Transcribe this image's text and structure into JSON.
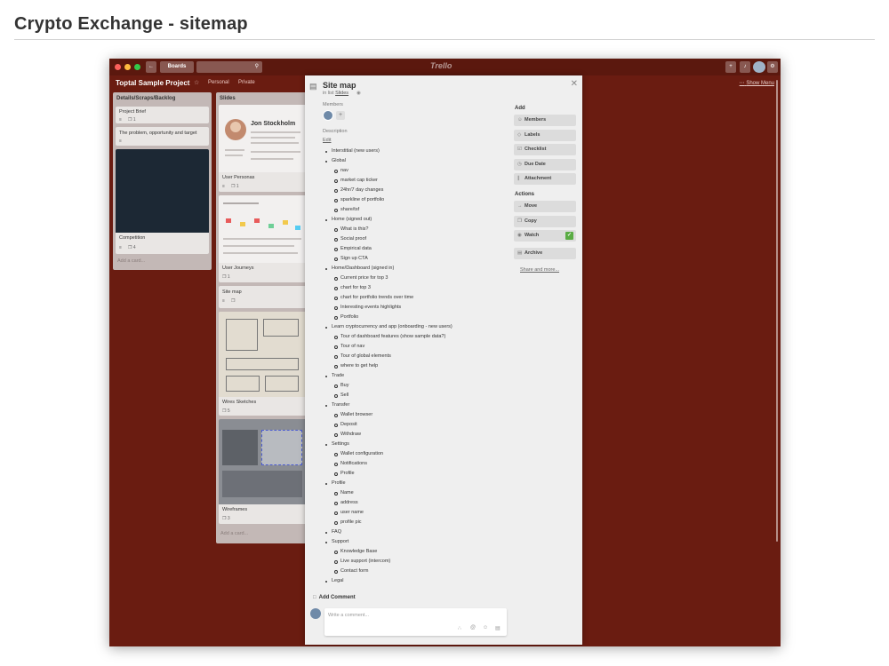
{
  "page": {
    "title": "Crypto Exchange - sitemap"
  },
  "topbar": {
    "boards_label": "Boards",
    "logo": "Trello",
    "icons": [
      "back-arrow-icon",
      "search-icon",
      "plus-icon",
      "bell-icon",
      "settings-icon"
    ]
  },
  "board": {
    "title": "Toptal Sample Project",
    "personal": "Personal",
    "private": "Private",
    "show_menu": "Show Menu"
  },
  "lists": [
    {
      "title": "Details/Scraps/Backlog",
      "cards": [
        {
          "title": "Project Brief",
          "badges": [
            "≡",
            "❐ 1"
          ]
        },
        {
          "title": "The problem, opportunity and target",
          "badges": [
            "≡"
          ]
        },
        {
          "title": "Competition",
          "badges": [
            "≡",
            "❐ 4"
          ]
        }
      ],
      "add_card": "Add a card..."
    },
    {
      "title": "Slides",
      "persona_name": "Jon Stockholm",
      "cards": [
        {
          "title": "User Personas",
          "badges": [
            "≡",
            "❐ 1"
          ]
        },
        {
          "title": "User Journeys",
          "badges": [
            "❐ 1"
          ]
        },
        {
          "title": "Site map",
          "badges": [
            "≡",
            "❐"
          ]
        },
        {
          "title": "Wires Sketches",
          "badges": [
            "❐ 5"
          ]
        },
        {
          "title": "Wireframes",
          "badges": [
            "❐ 3"
          ]
        }
      ],
      "add_card": "Add a card..."
    }
  ],
  "modal": {
    "title": "Site map",
    "in_list_prefix": "in list",
    "in_list_name": "Slides",
    "members_label": "Members",
    "description_label": "Description",
    "edit_label": "Edit",
    "sitemap": [
      {
        "text": "Interstitial (new users)",
        "level": 0
      },
      {
        "text": "Global",
        "level": 0
      },
      {
        "text": "nav",
        "level": 1
      },
      {
        "text": "market cap ticker",
        "level": 1
      },
      {
        "text": "24hr/7 day changes",
        "level": 1
      },
      {
        "text": "sparkline of portfolio",
        "level": 1
      },
      {
        "text": "share/tsf",
        "level": 1
      },
      {
        "text": "Home (signed out)",
        "level": 0
      },
      {
        "text": "What is this?",
        "level": 1
      },
      {
        "text": "Social proof",
        "level": 1
      },
      {
        "text": "Empirical data",
        "level": 1
      },
      {
        "text": "Sign up CTA",
        "level": 1
      },
      {
        "text": "Home/Dashboard (signed in)",
        "level": 0
      },
      {
        "text": "Current price for top 3",
        "level": 1
      },
      {
        "text": "chart for top 3",
        "level": 1
      },
      {
        "text": "chart for portfolio trends over time",
        "level": 1
      },
      {
        "text": "Interesting events highlights",
        "level": 1
      },
      {
        "text": "Portfolio",
        "level": 1
      },
      {
        "text": "Learn cryptocurrency and app (onboarding - new users)",
        "level": 0
      },
      {
        "text": "Tour of dashboard features (show sample data?)",
        "level": 1
      },
      {
        "text": "Tour of nav",
        "level": 1
      },
      {
        "text": "Tour of global elements",
        "level": 1
      },
      {
        "text": "where to get help",
        "level": 1
      },
      {
        "text": "Trade",
        "level": 0
      },
      {
        "text": "Buy",
        "level": 1
      },
      {
        "text": "Sell",
        "level": 1
      },
      {
        "text": "Transfer",
        "level": 0
      },
      {
        "text": "Wallet browser",
        "level": 1
      },
      {
        "text": "Deposit",
        "level": 1
      },
      {
        "text": "Withdraw",
        "level": 1
      },
      {
        "text": "Settings",
        "level": 0
      },
      {
        "text": "Wallet configuration",
        "level": 1
      },
      {
        "text": "Notifications",
        "level": 1
      },
      {
        "text": "Profile",
        "level": 1
      },
      {
        "text": "Profile",
        "level": 0
      },
      {
        "text": "Name",
        "level": 1
      },
      {
        "text": "address",
        "level": 1
      },
      {
        "text": "user name",
        "level": 1
      },
      {
        "text": "profile pic",
        "level": 1
      },
      {
        "text": "FAQ",
        "level": 0
      },
      {
        "text": "Support",
        "level": 0
      },
      {
        "text": "Knowledge Base",
        "level": 1
      },
      {
        "text": "Live support (intercom)",
        "level": 1
      },
      {
        "text": "Contact form",
        "level": 1
      },
      {
        "text": "Legal",
        "level": 0
      }
    ],
    "add_heading": "Add",
    "add_buttons": [
      {
        "icon": "person-icon",
        "glyph": "☺",
        "label": "Members"
      },
      {
        "icon": "tag-icon",
        "glyph": "◇",
        "label": "Labels"
      },
      {
        "icon": "checklist-icon",
        "glyph": "☑",
        "label": "Checklist"
      },
      {
        "icon": "clock-icon",
        "glyph": "◷",
        "label": "Due Date"
      },
      {
        "icon": "paperclip-icon",
        "glyph": "∥",
        "label": "Attachment"
      }
    ],
    "actions_heading": "Actions",
    "action_buttons": [
      {
        "icon": "arrow-right-icon",
        "glyph": "→",
        "label": "Move"
      },
      {
        "icon": "copy-icon",
        "glyph": "❐",
        "label": "Copy"
      },
      {
        "icon": "eye-icon",
        "glyph": "◉",
        "label": "Watch"
      },
      {
        "icon": "archive-icon",
        "glyph": "▤",
        "label": "Archive"
      }
    ],
    "watch_checked": true,
    "share_more": "Share and more...",
    "add_comment_heading": "Add Comment",
    "comment_placeholder": "Write a comment..."
  }
}
